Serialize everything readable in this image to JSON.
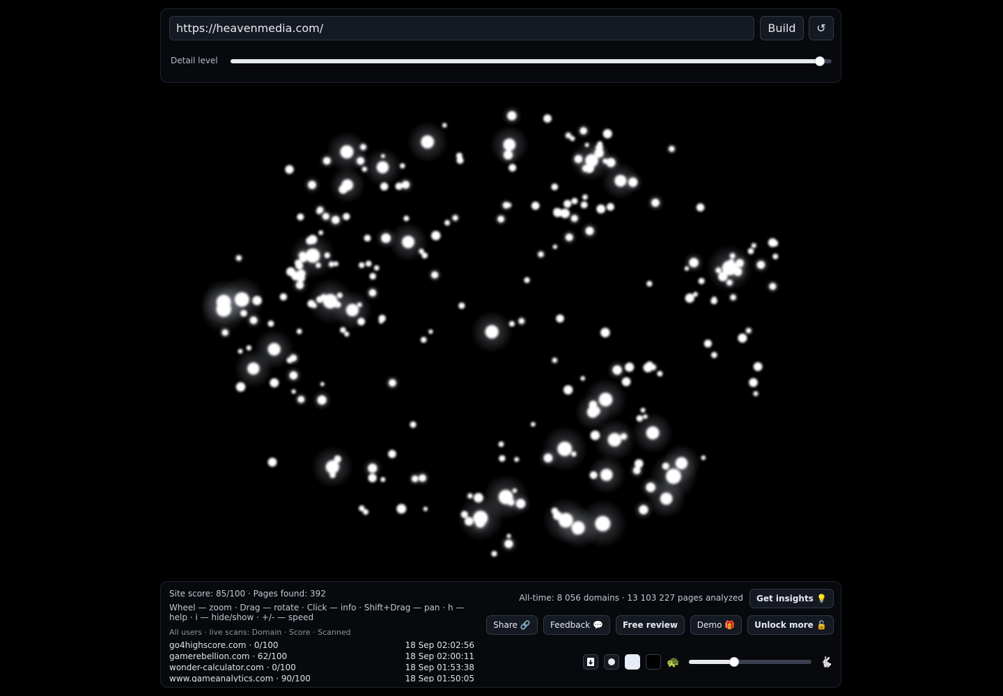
{
  "toolbar": {
    "url_value": "https://heavenmedia.com/",
    "build_label": "Build",
    "reset_icon": "↺",
    "detail_label": "Detail level",
    "detail_value": 0.98
  },
  "footer": {
    "site_score": "Site score: 85/100 · Pages found: 392",
    "help": "Wheel — zoom · Drag — rotate · Click — info · Shift+Drag — pan · h — help · i — hide/show · +/- — speed",
    "list_header": "All users · live scans: Domain · Score · Scanned",
    "scans": [
      {
        "domain": "go4highscore.com · 0/100",
        "time": "18 Sep 02:02:56"
      },
      {
        "domain": "gamerebellion.com · 62/100",
        "time": "18 Sep 02:00:11"
      },
      {
        "domain": "wonder-calculator.com · 0/100",
        "time": "18 Sep 01:53:38"
      },
      {
        "domain": "www.gameanalytics.com · 90/100",
        "time": "18 Sep 01:50:05"
      }
    ],
    "all_time": "All-time: 8 056 domains · 13 103 227 pages analyzed",
    "get_insights": "Get insights 💡",
    "share": "Share 🔗",
    "feedback": "Feedback 💬",
    "free_review": "Free review",
    "demo": "Demo 🎁",
    "unlock": "Unlock more 🔓",
    "speed_slow_icon": "🐢",
    "speed_fast_icon": "🐇",
    "speed_value": 0.37
  },
  "colors": {
    "background": "#000000",
    "panel": "#07090d",
    "node": "#ffffff",
    "glow": "#cfd6e6"
  }
}
